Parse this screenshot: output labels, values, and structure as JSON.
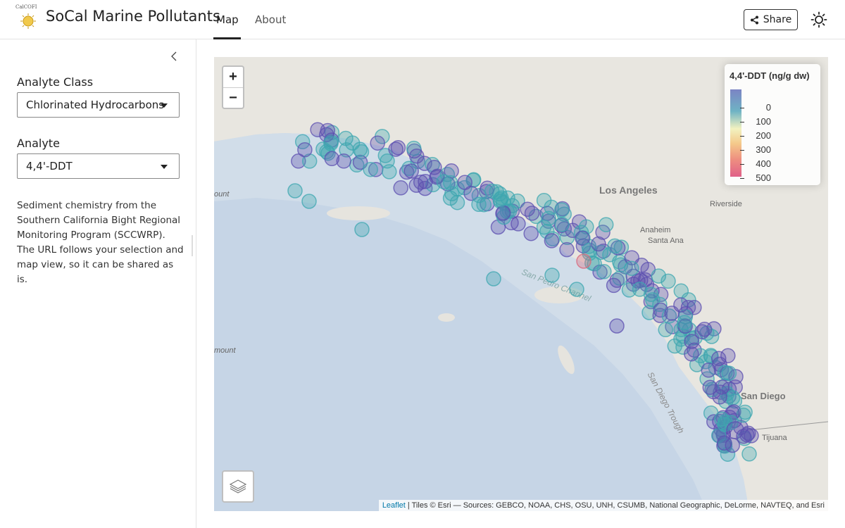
{
  "header": {
    "logo_text": "CalCOFI",
    "app_title": "SoCal Marine Pollutants",
    "tabs": [
      {
        "label": "Map",
        "active": true
      },
      {
        "label": "About",
        "active": false
      }
    ],
    "share_label": "Share",
    "share_icon": "share-icon",
    "theme_icon": "sun-icon"
  },
  "sidebar": {
    "analyte_class_label": "Analyte Class",
    "analyte_class_value": "Chlorinated Hydrocarbons",
    "analyte_label": "Analyte",
    "analyte_value": "4,4'-DDT",
    "description": "Sediment chemistry from the Southern California Bight Regional Monitoring Program (SCCWRP). The URL follows your selection and map view, so it can be shared as is."
  },
  "map": {
    "zoom_in": "+",
    "zoom_out": "−",
    "legend": {
      "title": "4,4'-DDT (ng/g dw)",
      "ticks": [
        "0",
        "100",
        "200",
        "300",
        "400",
        "500"
      ],
      "colors": [
        "#7b84c4",
        "#6fb3c4",
        "#f2f2c0",
        "#f4c98a",
        "#ee8f80",
        "#e06088"
      ]
    },
    "place_labels": {
      "los_angeles": "Los Angeles",
      "riverside": "Riverside",
      "anaheim": "Anaheim",
      "santa_ana": "Santa Ana",
      "san_diego": "San Diego",
      "tijuana": "Tijuana",
      "san_pedro_channel": "San Pedro Channel",
      "san_diego_trough": "San Diego Trough",
      "mount1": "ount",
      "mount2": "mount"
    },
    "attribution": {
      "leaflet": "Leaflet",
      "text": "| Tiles © Esri — Sources: GEBCO, NOAA, CHS, OSU, UNH, CSUMB, National Geographic, DeLorme, NAVTEQ, and Esri"
    },
    "colors": {
      "low_dot": "#5c4fb0",
      "mid_dot": "#3ea7b0",
      "high_dot": "#d9667a"
    }
  }
}
